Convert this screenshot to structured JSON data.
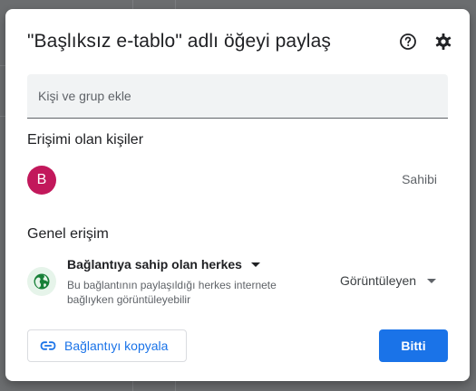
{
  "dialog": {
    "title": "\"Başlıksız e-tablo\" adlı öğeyi paylaş",
    "help_icon": "help-circle-icon",
    "settings_icon": "gear-icon"
  },
  "add_people": {
    "placeholder": "Kişi ve grup ekle",
    "value": ""
  },
  "people_with_access": {
    "title": "Erişimi olan kişiler",
    "people": [
      {
        "avatar_letter": "B",
        "avatar_color": "#c2185b",
        "role": "Sahibi"
      }
    ]
  },
  "general_access": {
    "title": "Genel erişim",
    "icon": "globe-icon",
    "icon_color": "#188038",
    "selected_option": "Bağlantıya sahip olan herkes",
    "description": "Bu bağlantının paylaşıldığı herkes internete bağlıyken görüntüleyebilir",
    "role": "Görüntüleyen"
  },
  "footer": {
    "copy_link_label": "Bağlantıyı kopyala",
    "copy_link_icon": "link-icon",
    "done_label": "Bitti"
  },
  "colors": {
    "accent": "#1a73e8",
    "text_primary": "#202124",
    "text_secondary": "#5f6368"
  }
}
